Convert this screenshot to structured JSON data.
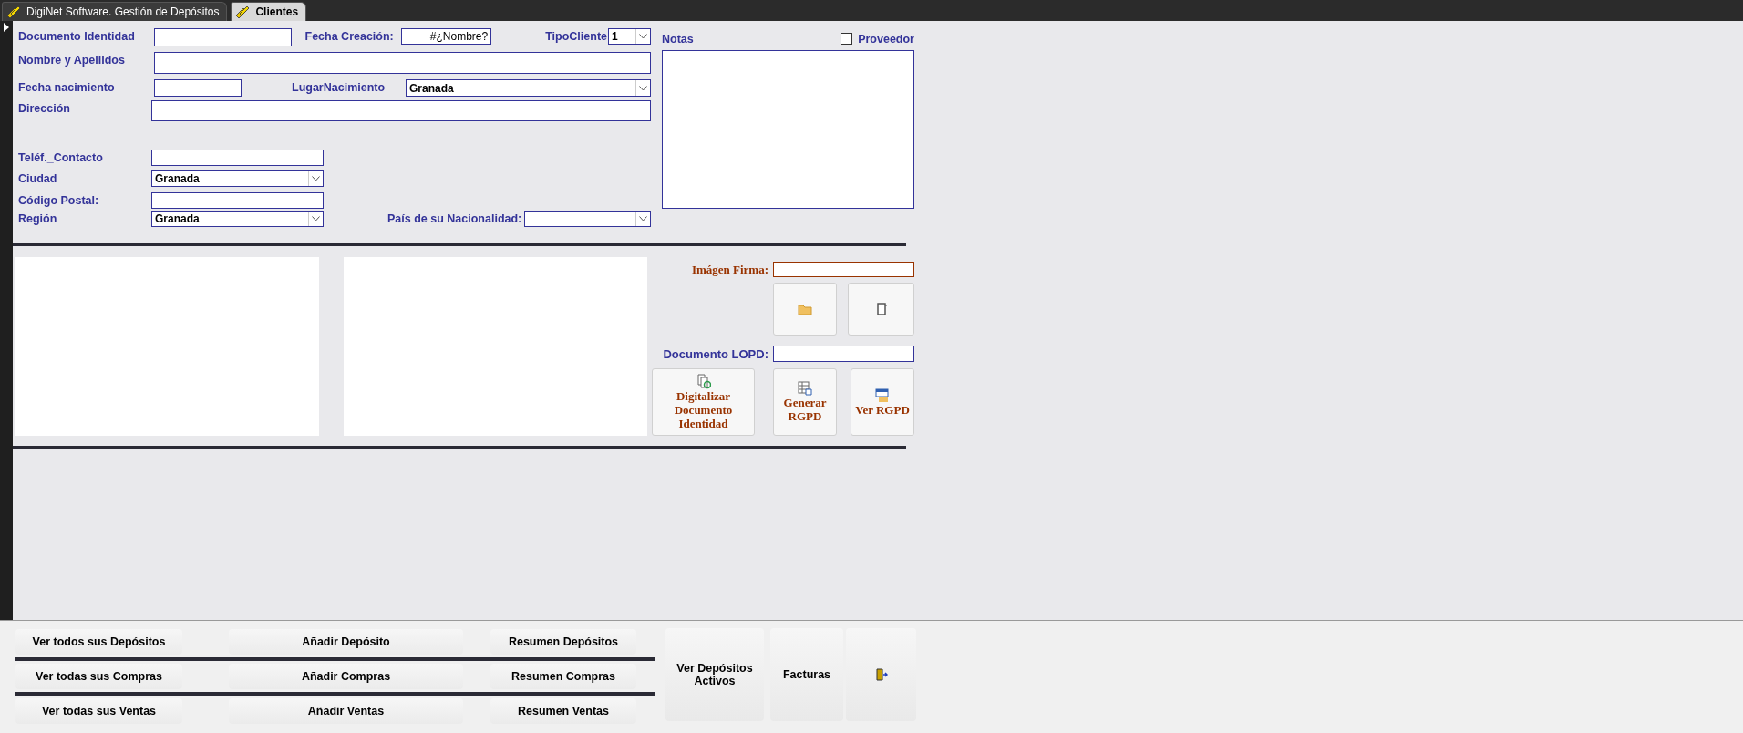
{
  "tabs": [
    {
      "label": "DigiNet Software. Gestión de Depósitos",
      "selected": false
    },
    {
      "label": "Clientes",
      "selected": true
    }
  ],
  "fields": [
    {
      "label": "Documento Identidad",
      "kind": "text"
    },
    {
      "label": "Fecha Creación:",
      "kind": "text",
      "value": "#¿Nombre?"
    },
    {
      "label": "TipoCliente",
      "kind": "combo",
      "value": "1"
    },
    {
      "label": "Nombre y Apellidos",
      "kind": "text"
    },
    {
      "label": "Fecha nacimiento",
      "kind": "text"
    },
    {
      "label": "LugarNacimiento",
      "kind": "combo",
      "value": "Granada"
    },
    {
      "label": "Dirección",
      "kind": "text"
    },
    {
      "label": "Teléf._Contacto",
      "kind": "text"
    },
    {
      "label": "Ciudad",
      "kind": "combo",
      "value": "Granada"
    },
    {
      "label": "Código Postal:",
      "kind": "text"
    },
    {
      "label": "Región",
      "kind": "combo",
      "value": "Granada"
    },
    {
      "label": "País de su Nacionalidad:",
      "kind": "combo"
    }
  ],
  "notes": {
    "label": "Notas"
  },
  "proveedor": {
    "label": "Proveedor",
    "checked": false
  },
  "signature": {
    "label": "Imágen Firma:"
  },
  "lopd": {
    "label": "Documento LOPD:"
  },
  "document_buttons": [
    {
      "label": "Digitalizar Documento Identidad",
      "kind": "scan"
    },
    {
      "label": "Generar RGPD",
      "kind": "generate"
    },
    {
      "label": "Ver RGPD",
      "kind": "view"
    }
  ],
  "bottom_buttons": [
    [
      "Ver todos sus Depósitos",
      "Añadir Depósito",
      "Resumen Depósitos"
    ],
    [
      "Ver todas sus Compras",
      "Añadir Compras",
      "Resumen Compras"
    ],
    [
      "Ver todas sus Ventas",
      "Añadir Ventas",
      "Resumen Ventas"
    ]
  ],
  "side_buttons": [
    {
      "label": "Ver Depósitos Activos",
      "kind": "text"
    },
    {
      "label": "Facturas",
      "kind": "text"
    },
    {
      "kind": "exit"
    }
  ]
}
